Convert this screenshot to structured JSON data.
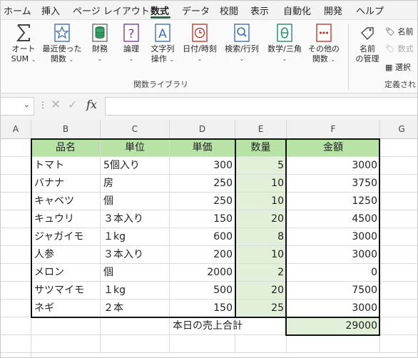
{
  "tabs": [
    "ホーム",
    "挿入",
    "ページ レイアウト",
    "数式",
    "データ",
    "校閲",
    "表示",
    "自動化",
    "開発",
    "ヘルプ"
  ],
  "active_tab": "数式",
  "ribbon": {
    "autosum": {
      "line1": "オート",
      "line2": "SUM",
      "icon": "sigma-icon"
    },
    "recent": {
      "line1": "最近使った",
      "line2": "関数",
      "icon": "star-icon"
    },
    "financial": {
      "line1": "財務",
      "icon": "database-icon"
    },
    "logical": {
      "line1": "論理",
      "icon": "question-icon"
    },
    "text": {
      "line1": "文字列",
      "line2": "操作",
      "icon": "letter-a-icon"
    },
    "datetime": {
      "line1": "日付/時刻",
      "icon": "clock-icon"
    },
    "lookup": {
      "line1": "検索/行列",
      "icon": "magnifier-icon"
    },
    "math": {
      "line1": "数学/三角",
      "icon": "theta-icon"
    },
    "more": {
      "line1": "その他の",
      "line2": "関数",
      "icon": "dots-icon"
    },
    "group_label": "関数ライブラリ",
    "name_manager": {
      "line1": "名前",
      "line2": "の管理",
      "icon": "tag-icon"
    },
    "define_name": "名前",
    "use_in_formula": "数式",
    "create_from_selection": "選択",
    "defined_names_label": "定義され"
  },
  "formula_bar": {
    "name_box": "",
    "fx": "fx",
    "formula": ""
  },
  "columns": [
    "A",
    "B",
    "C",
    "D",
    "E",
    "F",
    "G"
  ],
  "table": {
    "headers": [
      "品名",
      "単位",
      "単価",
      "数量",
      "金額"
    ],
    "rows": [
      [
        "トマト",
        "5個入り",
        "300",
        "5",
        "3000"
      ],
      [
        "バナナ",
        "房",
        "250",
        "10",
        "3750"
      ],
      [
        "キャベツ",
        "個",
        "250",
        "10",
        "1250"
      ],
      [
        "キュウリ",
        "３本入り",
        "150",
        "20",
        "4500"
      ],
      [
        "ジャガイモ",
        "１kg",
        "600",
        "8",
        "3000"
      ],
      [
        "人参",
        "３本入り",
        "200",
        "10",
        "3000"
      ],
      [
        "メロン",
        "個",
        "2000",
        "2",
        "0"
      ],
      [
        "サツマイモ",
        "１kg",
        "500",
        "20",
        "7500"
      ],
      [
        "ネギ",
        "２本",
        "150",
        "25",
        "3000"
      ]
    ],
    "total_label": "本日の売上合計",
    "total_value": "29000"
  },
  "colors": {
    "header_green": "#b8e3a6",
    "qty_green": "#e2f0d9",
    "accent": "#1f7145"
  }
}
